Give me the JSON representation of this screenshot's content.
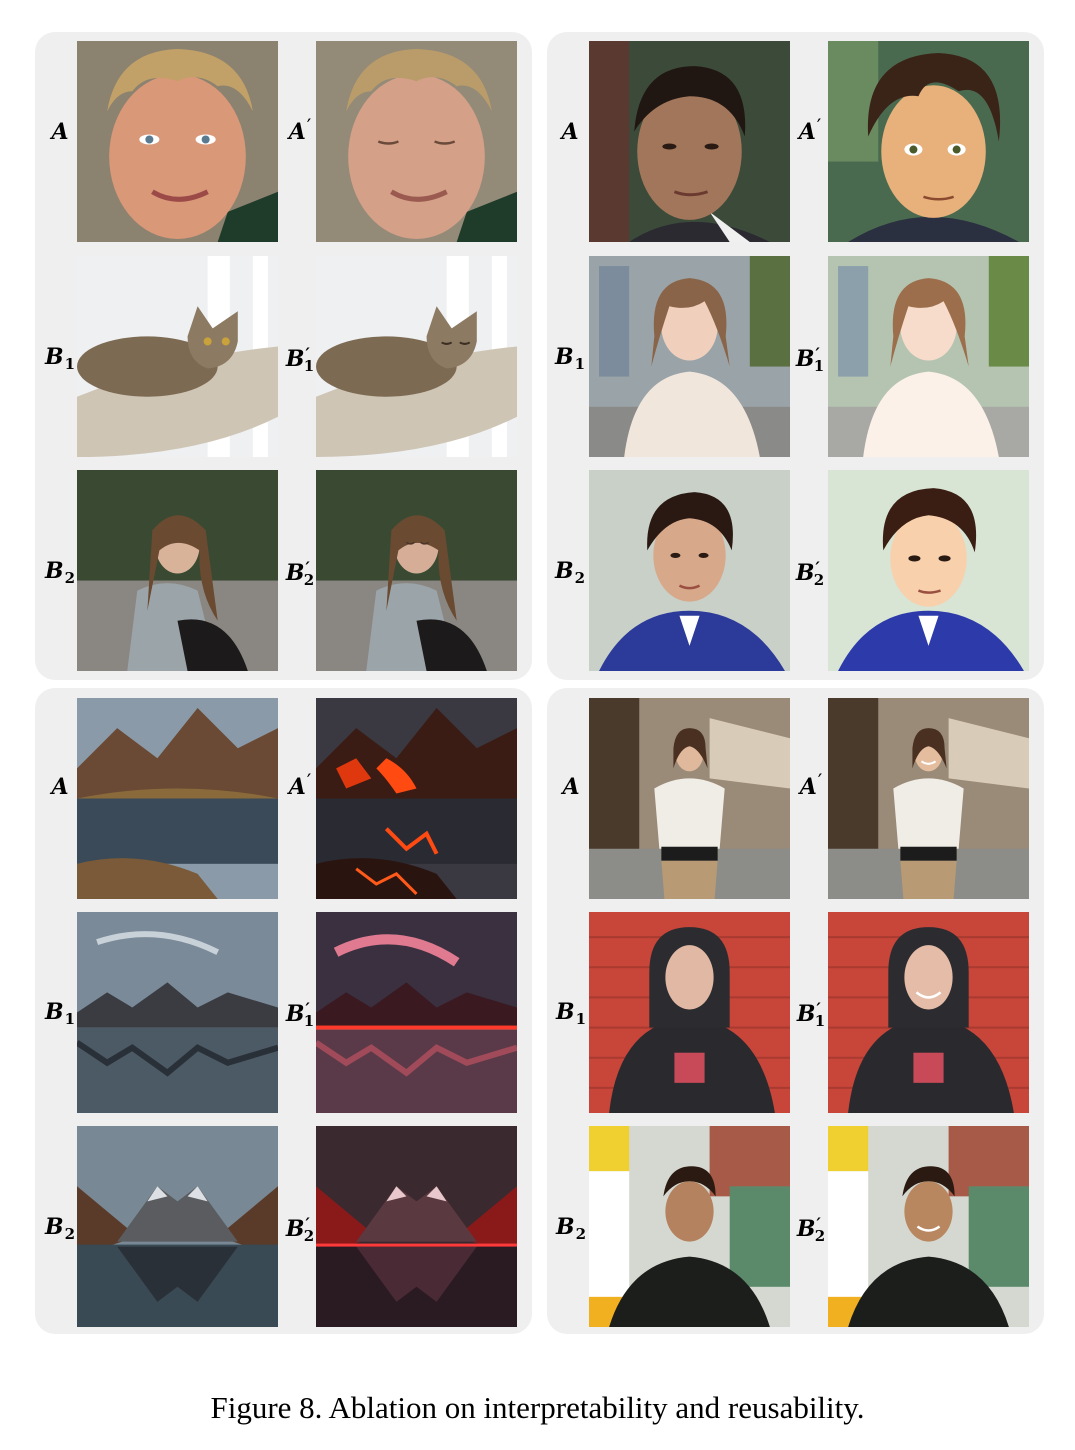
{
  "caption": "Figure 8. Ablation on interpretability and reusability.",
  "labels": {
    "A": "A",
    "B1": "B",
    "B2": "B",
    "sub1": "1",
    "sub2": "2",
    "prime": "′"
  },
  "panels": [
    {
      "name": "eyes-closed-edit",
      "rows": [
        "A",
        "B1",
        "B2"
      ]
    },
    {
      "name": "anime-style-edit",
      "rows": [
        "A",
        "B1",
        "B2"
      ]
    },
    {
      "name": "lava-landscape-edit",
      "rows": [
        "A",
        "B1",
        "B2"
      ]
    },
    {
      "name": "smile-edit",
      "rows": [
        "A",
        "B1",
        "B2"
      ]
    }
  ],
  "colors": {
    "panel_bg": "#efefef",
    "red_wall": "#c8453a",
    "lava": "#ff4a12"
  }
}
